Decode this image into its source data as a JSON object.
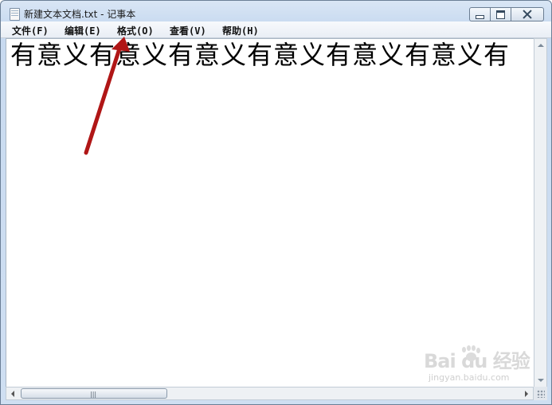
{
  "window": {
    "title": "新建文本文档.txt - 记事本"
  },
  "menu": [
    {
      "label": "文件(F)"
    },
    {
      "label": "编辑(E)"
    },
    {
      "label": "格式(O)"
    },
    {
      "label": "查看(V)"
    },
    {
      "label": "帮助(H)"
    }
  ],
  "editor": {
    "content": "有意义有意义有意义有意义有意义有意义有"
  },
  "icons": {
    "app": "notepad-icon",
    "minimize": "minimize-icon",
    "maximize": "maximize-icon",
    "close": "close-icon",
    "scroll_up": "arrow-up-icon",
    "scroll_down": "arrow-down-icon",
    "scroll_left": "arrow-left-icon",
    "scroll_right": "arrow-right-icon",
    "grip": "grip-icon"
  },
  "watermark": {
    "main": "Bai  du 经验",
    "sub": "jingyan.baidu.com"
  },
  "annotation": {
    "color": "#b01616",
    "target": "格式(O)"
  }
}
